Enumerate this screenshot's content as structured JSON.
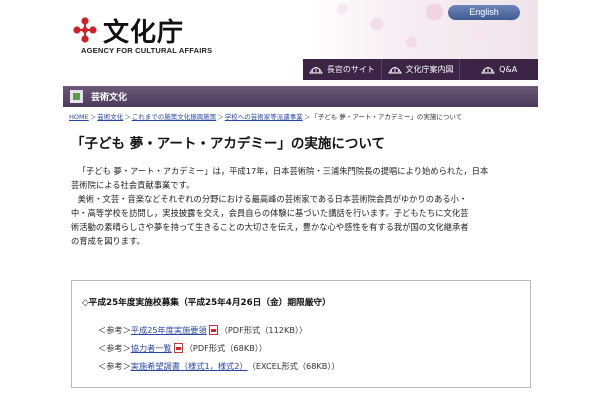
{
  "header": {
    "english_label": "English",
    "logo_text": "文化庁",
    "logo_sub": "AGENCY FOR CULTURAL AFFAIRS",
    "nav": [
      {
        "label": "長官のサイト"
      },
      {
        "label": "文化庁案内図"
      },
      {
        "label": "Q&A"
      }
    ]
  },
  "section": {
    "label": "芸術文化"
  },
  "breadcrumb": {
    "items": [
      "HOME",
      "芸術文化",
      "これまでの施策文化振興施策",
      "学校への芸術家等派遣事業"
    ],
    "current": "「子ども 夢・アート・アカデミー」の実施について"
  },
  "page_title": "「子ども 夢・アート・アカデミー」の実施について",
  "body": {
    "para1_line1": "「子ども 夢・アート・アカデミー」は，平成17年，日本芸術院・三浦朱門院長の提唱により始められた，日本",
    "para1_line2": "芸術院による社会貢献事業です。",
    "para2_line1": "美術・文芸・音楽などそれぞれの分野における最高峰の芸術家である日本芸術院会員がゆかりのある小・",
    "para2_line2": "中・高等学校を訪問し，実技披露を交え，会員自らの体験に基づいた講話を行います。子どもたちに文化芸",
    "para2_line3": "術活動の素晴らしさや夢を持って生きることの大切さを伝え，豊かな心や感性を有する我が国の文化継承者",
    "para2_line4": "の育成を図ります。"
  },
  "box": {
    "heading": "◇平成25年度実施校募集（平成25年4月26日（金）期限厳守）",
    "refs": [
      {
        "prefix": "＜参考＞",
        "link": "平成25年度実施要領",
        "format": "（PDF形式（112KB））",
        "pdf": true
      },
      {
        "prefix": "＜参考＞",
        "link": "協力者一覧",
        "format": "（PDF形式（68KB））",
        "pdf": true
      },
      {
        "prefix": "＜参考＞",
        "link": "実施希望調書（様式1，様式2）",
        "format": "（EXCEL形式（68KB））",
        "pdf": false
      }
    ]
  },
  "colors": {
    "nav_bg": "#3b2446",
    "section_bg": "#5a4a68",
    "link": "#2a45a8",
    "logo_red": "#d0202a"
  },
  "icons": [
    "agency-logo-icon",
    "fan-icon",
    "section-icon",
    "pdf-icon"
  ]
}
